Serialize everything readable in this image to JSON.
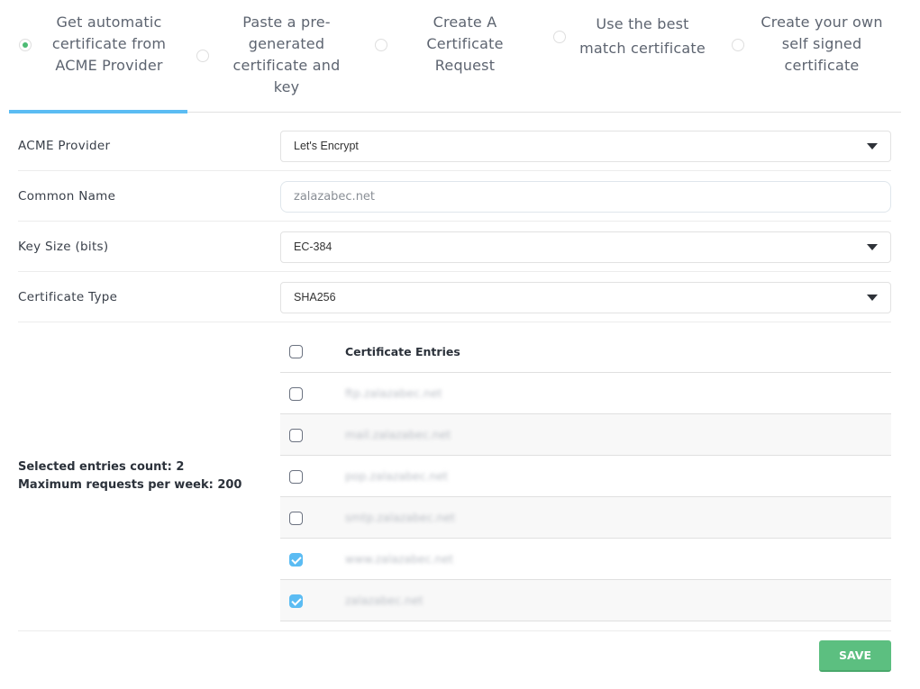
{
  "tabs": [
    {
      "label": "Get automatic certificate from ACME Provider",
      "selected": true
    },
    {
      "label": "Paste a pre-generated certificate and key",
      "selected": false
    },
    {
      "label": "Create A Certificate Request",
      "selected": false
    },
    {
      "label": "Use the best match certificate",
      "selected": false
    },
    {
      "label": "Create your own self signed certificate",
      "selected": false
    }
  ],
  "form": {
    "acme_provider": {
      "label": "ACME Provider",
      "value": "Let's Encrypt"
    },
    "common_name": {
      "label": "Common Name",
      "placeholder": "zalazabec.net"
    },
    "key_size": {
      "label": "Key Size (bits)",
      "value": "EC-384"
    },
    "certificate_type": {
      "label": "Certificate Type",
      "value": "SHA256"
    }
  },
  "entries": {
    "header": "Certificate Entries",
    "summary_selected": "Selected entries count: 2",
    "summary_max": "Maximum requests per week: 200",
    "rows": [
      {
        "name": "ftp.zalazabec.net",
        "checked": false
      },
      {
        "name": "mail.zalazabec.net",
        "checked": false
      },
      {
        "name": "pop.zalazabec.net",
        "checked": false
      },
      {
        "name": "smtp.zalazabec.net",
        "checked": false
      },
      {
        "name": "www.zalazabec.net",
        "checked": true
      },
      {
        "name": "zalazabec.net",
        "checked": true
      }
    ]
  },
  "actions": {
    "save_label": "SAVE"
  },
  "colors": {
    "accent": "#5bbcf3",
    "save": "#5cbf80",
    "selected_radio": "#4cbb74"
  }
}
